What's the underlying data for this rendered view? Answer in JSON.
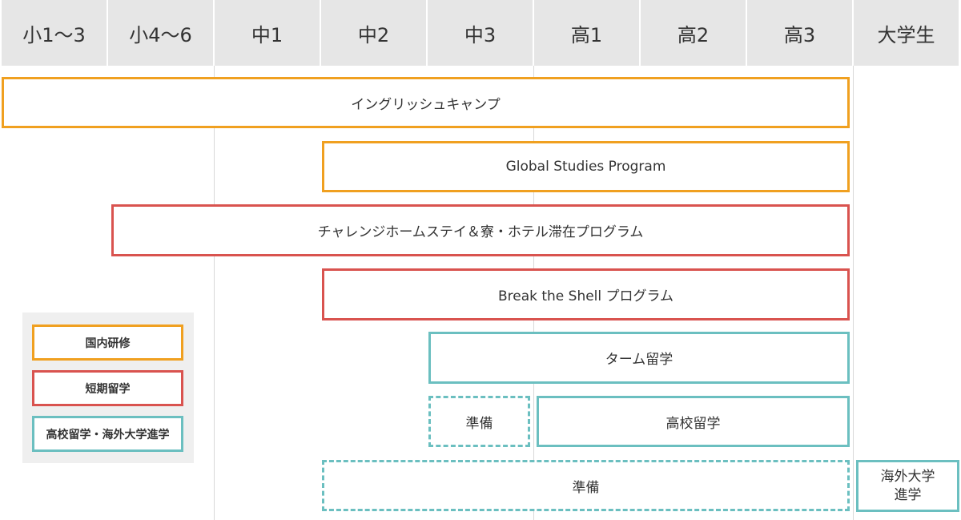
{
  "columns": [
    "小1〜3",
    "小4〜6",
    "中1",
    "中2",
    "中3",
    "高1",
    "高2",
    "高3",
    "大学生"
  ],
  "programs": {
    "english_camp": "イングリッシュキャンプ",
    "global_studies": "Global Studies Program",
    "challenge_homestay": "チャレンジホームステイ＆寮・ホテル滞在プログラム",
    "break_shell": "Break the Shell プログラム",
    "term_study": "ターム留学",
    "prep_short": "準備",
    "high_school_study": "高校留学",
    "prep_long": "準備",
    "overseas_univ_line1": "海外大学",
    "overseas_univ_line2": "進学"
  },
  "legend": {
    "domestic": "国内研修",
    "short_term": "短期留学",
    "high_school_overseas": "高校留学・海外大学進学"
  },
  "colors": {
    "domestic": "#f0a020",
    "short_term": "#d9534f",
    "high_school_overseas": "#6bbfc0",
    "header_bg": "#e6e6e6"
  }
}
